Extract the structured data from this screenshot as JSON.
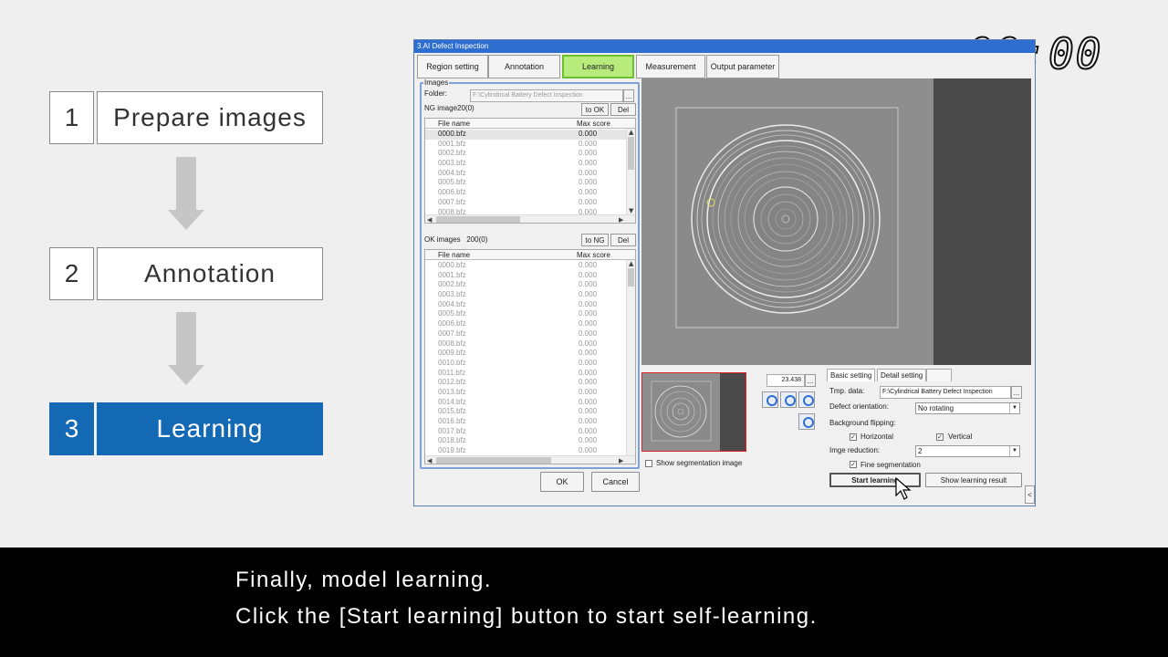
{
  "steps": [
    {
      "num": "1",
      "label": "Prepare images"
    },
    {
      "num": "2",
      "label": "Annotation"
    },
    {
      "num": "3",
      "label": "Learning"
    }
  ],
  "timer": "00:00",
  "window": {
    "title": "3.AI Defect Inspection",
    "tabs": [
      "Region setting",
      "Annotation",
      "Learning",
      "Measurement",
      "Output parameter"
    ],
    "active_tab": "Learning"
  },
  "images_panel": {
    "group_title": "Images",
    "folder_label": "Folder:",
    "folder_value": "F:\\Cylindrical Battery Defect Inspection",
    "browse_label": "...",
    "ng": {
      "label": "NG image",
      "count": "20(0)",
      "to_btn": "to OK",
      "del_btn": "Del",
      "col_file": "File name",
      "col_score": "Max score",
      "rows": [
        [
          "0000.bfz",
          "0.000"
        ],
        [
          "0001.bfz",
          "0.000"
        ],
        [
          "0002.bfz",
          "0.000"
        ],
        [
          "0003.bfz",
          "0.000"
        ],
        [
          "0004.bfz",
          "0.000"
        ],
        [
          "0005.bfz",
          "0.000"
        ],
        [
          "0006.bfz",
          "0.000"
        ],
        [
          "0007.bfz",
          "0.000"
        ],
        [
          "0008.bfz",
          "0.000"
        ]
      ]
    },
    "ok": {
      "label": "OK images",
      "count": "200(0)",
      "to_btn": "to NG",
      "del_btn": "Del",
      "col_file": "File name",
      "col_score": "Max score",
      "rows": [
        [
          "0000.bfz",
          "0.000"
        ],
        [
          "0001.bfz",
          "0.000"
        ],
        [
          "0002.bfz",
          "0.000"
        ],
        [
          "0003.bfz",
          "0.000"
        ],
        [
          "0004.bfz",
          "0.000"
        ],
        [
          "0005.bfz",
          "0.000"
        ],
        [
          "0006.bfz",
          "0.000"
        ],
        [
          "0007.bfz",
          "0.000"
        ],
        [
          "0008.bfz",
          "0.000"
        ],
        [
          "0009.bfz",
          "0.000"
        ],
        [
          "0010.bfz",
          "0.000"
        ],
        [
          "0011.bfz",
          "0.000"
        ],
        [
          "0012.bfz",
          "0.000"
        ],
        [
          "0013.bfz",
          "0.000"
        ],
        [
          "0014.bfz",
          "0.000"
        ],
        [
          "0015.bfz",
          "0.000"
        ],
        [
          "0016.bfz",
          "0.000"
        ],
        [
          "0017.bfz",
          "0.000"
        ],
        [
          "0018.bfz",
          "0.000"
        ],
        [
          "0019.bfz",
          "0.000"
        ]
      ]
    }
  },
  "buttons": {
    "ok": "OK",
    "cancel": "Cancel"
  },
  "viewer": {
    "zoom_value": "23.438",
    "zoom_btn": "...",
    "show_seg_label": "Show segmentation image"
  },
  "settings": {
    "tab_basic": "Basic setting",
    "tab_detail": "Detail setting",
    "tmp_label": "Tmp. data:",
    "tmp_value": "F:\\Cylindrical Battery Defect Inspection",
    "tmp_btn": "...",
    "orientation_label": "Defect orientation:",
    "orientation_value": "No rotating",
    "bg_flip_label": "Background flipping:",
    "horizontal_label": "Horizontal",
    "vertical_label": "Vertical",
    "reduction_label": "Imge reduction:",
    "reduction_value": "2",
    "fine_seg_label": "Fine segmentation",
    "start_btn": "Start learning",
    "show_result_btn": "Show learning result",
    "side_arrow": "<"
  },
  "subtitle": [
    "Finally, model learning.",
    "Click the [Start learning] button to start self-learning."
  ]
}
